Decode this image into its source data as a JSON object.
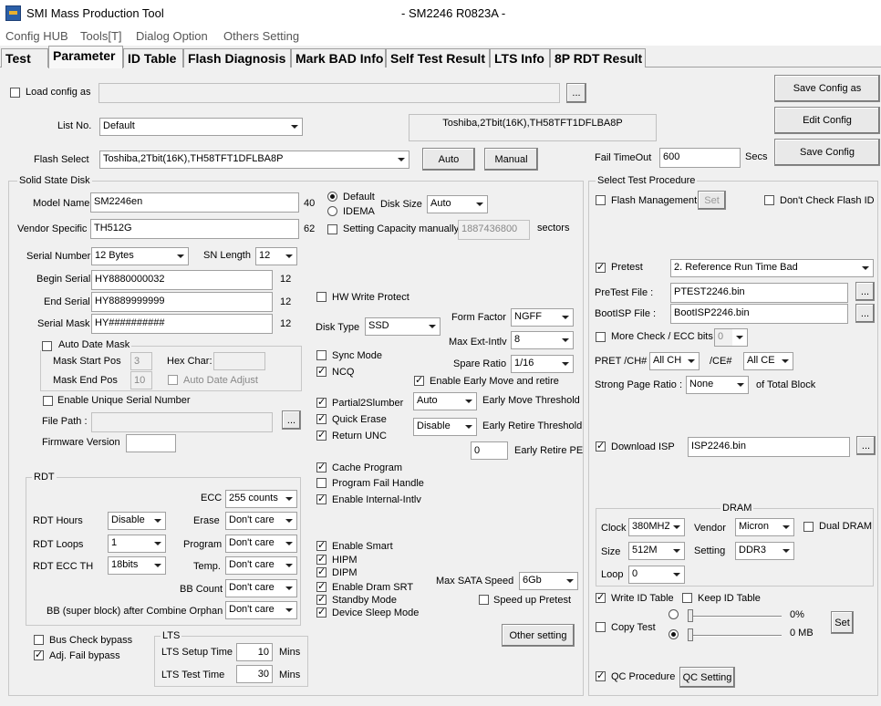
{
  "window": {
    "title": "SMI Mass Production Tool",
    "subtitle": "- SM2246 R0823A -"
  },
  "menu": [
    "Config HUB",
    "Tools[T]",
    "Dialog Option",
    "Others Setting"
  ],
  "tabs": [
    "Test",
    "Parameter",
    "ID Table",
    "Flash Diagnosis",
    "Mark BAD Info",
    "Self Test Result",
    "LTS Info",
    "8P RDT Result"
  ],
  "top": {
    "load_config_label": "Load config as",
    "load_config_value": "",
    "browse": "...",
    "list_no_label": "List No.",
    "list_no_value": "Default",
    "flash_info": "Toshiba,2Tbit(16K),TH58TFT1DFLBA8P",
    "flash_select_label": "Flash Select",
    "flash_select_value": "Toshiba,2Tbit(16K),TH58TFT1DFLBA8P",
    "auto_button": "Auto",
    "manual_button": "Manual",
    "fail_timeout_label": "Fail TimeOut",
    "fail_timeout_value": "600",
    "secs": "Secs",
    "save_config_as": "Save Config as",
    "edit_config": "Edit Config",
    "save_config": "Save Config"
  },
  "ssd": {
    "title": "Solid State Disk",
    "model_name_label": "Model Name",
    "model_name_value": "SM2246en",
    "model_len": "40",
    "vendor_label": "Vendor Specific",
    "vendor_value": "TH512G",
    "vendor_len": "62",
    "default_label": "Default",
    "idema_label": "IDEMA",
    "disk_size_label": "Disk Size",
    "disk_size_value": "Auto",
    "setting_capacity_label": "Setting Capacity manually",
    "capacity_value": "1887436800",
    "sectors": "sectors",
    "serial_number_label": "Serial Number",
    "serial_number_value": "12 Bytes",
    "sn_length_label": "SN Length",
    "sn_length_value": "12",
    "begin_serial_label": "Begin Serial",
    "begin_serial_value": "HY8880000032",
    "begin_len": "12",
    "end_serial_label": "End Serial",
    "end_serial_value": "HY8889999999",
    "end_len": "12",
    "serial_mask_label": "Serial Mask",
    "serial_mask_value": "HY##########",
    "mask_len": "12",
    "auto_date_mask": "Auto Date Mask",
    "mask_start_label": "Mask Start Pos",
    "mask_start_value": "3",
    "hex_char_label": "Hex Char:",
    "hex_char_value": "",
    "mask_end_label": "Mask End Pos",
    "mask_end_value": "10",
    "auto_date_adjust": "Auto Date Adjust",
    "enable_unique": "Enable Unique Serial Number",
    "file_path_label": "File Path :",
    "file_path_value": "",
    "firmware_label": "Firmware Version",
    "firmware_value": "",
    "hw_write_protect": "HW Write Protect",
    "disk_type_label": "Disk Type",
    "disk_type_value": "SSD",
    "form_factor_label": "Form Factor",
    "form_factor_value": "NGFF",
    "max_ext_label": "Max Ext-Intlv",
    "max_ext_value": "8",
    "spare_ratio_label": "Spare Ratio",
    "spare_ratio_value": "1/16",
    "sync_mode": "Sync Mode",
    "ncq": "NCQ",
    "early_move": "Enable Early Move and retire",
    "partial": "Partial2Slumber",
    "quick_erase": "Quick Erase",
    "return_unc": "Return UNC",
    "early_move_value": "Auto",
    "early_move_label": "Early Move Threshold",
    "early_retire_value": "Disable",
    "early_retire_label": "Early Retire Threshold",
    "early_retire_pe_value": "0",
    "early_retire_pe_label": "Early Retire PE",
    "cache_program": "Cache Program",
    "program_fail": "Program Fail Handle",
    "internal_intlv": "Enable Internal-Intlv",
    "enable_smart": "Enable Smart",
    "hipm": "HIPM",
    "dipm": "DIPM",
    "dram_srt": "Enable Dram SRT",
    "standby": "Standby Mode",
    "device_sleep": "Device Sleep Mode",
    "max_sata_label": "Max SATA Speed",
    "max_sata_value": "6Gb",
    "speed_up": "Speed up Pretest",
    "other_setting": "Other setting"
  },
  "rdt": {
    "title": "RDT",
    "ecc_label": "ECC",
    "ecc_value": "255 counts",
    "hours_label": "RDT Hours",
    "hours_value": "Disable",
    "erase_label": "Erase",
    "erase_value": "Don't care",
    "loops_label": "RDT Loops",
    "loops_value": "1",
    "program_label": "Program",
    "program_value": "Don't care",
    "ecc_th_label": "RDT ECC TH",
    "ecc_th_value": "18bits",
    "temp_label": "Temp.",
    "temp_value": "Don't care",
    "bb_count_label": "BB Count",
    "bb_count_value": "Don't care",
    "bb_super_label": "BB (super block) after Combine Orphan",
    "bb_super_value": "Don't care"
  },
  "bottom": {
    "bus_check": "Bus Check bypass",
    "adj_fail": "Adj. Fail bypass"
  },
  "lts": {
    "title": "LTS",
    "setup_label": "LTS Setup Time",
    "setup_value": "10",
    "test_label": "LTS Test Time",
    "test_value": "30",
    "mins": "Mins"
  },
  "procedure": {
    "title": "Select Test Procedure",
    "flash_mgmt": "Flash Management",
    "set": "Set",
    "dont_check": "Don't Check Flash ID",
    "pretest": "Pretest",
    "pretest_value": "2. Reference Run Time Bad",
    "pretest_file_label": "PreTest File :",
    "pretest_file_value": "PTEST2246.bin",
    "bootisp_label": "BootISP File :",
    "bootisp_value": "BootISP2246.bin",
    "more_check": "More Check / ECC bits",
    "more_check_value": "0",
    "pret_ch_label": "PRET /CH#",
    "pret_ch_value": "All CH",
    "ce_label": "/CE#",
    "ce_value": "All CE",
    "strong_page_label": "Strong Page Ratio :",
    "strong_page_value": "None",
    "of_total": "of Total Block",
    "download_isp": "Download ISP",
    "isp_value": "ISP2246.bin",
    "dram_title": "DRAM",
    "clock_label": "Clock",
    "clock_value": "380MHZ",
    "vendor_label": "Vendor",
    "vendor_value": "Micron",
    "dual_dram": "Dual DRAM",
    "size_label": "Size",
    "size_value": "512M",
    "setting_label": "Setting",
    "setting_value": "DDR3",
    "loop_label": "Loop",
    "loop_value": "0",
    "write_id": "Write ID Table",
    "keep_id": "Keep ID Table",
    "copy_test": "Copy Test",
    "pct": "0%",
    "mb": "0 MB",
    "copy_set": "Set",
    "qc_procedure": "QC Procedure",
    "qc_setting": "QC Setting"
  }
}
